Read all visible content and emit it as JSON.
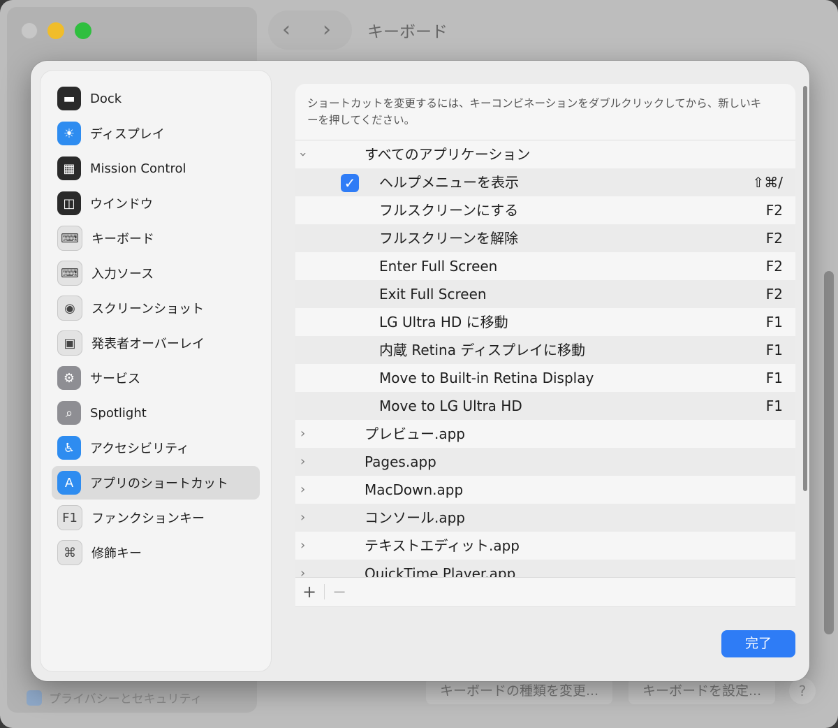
{
  "window": {
    "title": "キーボード",
    "nav_back": "‹",
    "nav_forward": "›",
    "privacy_label": "プライバシーとセキュリティ",
    "change_keyboard_type_button": "キーボードの種類を変更...",
    "setup_keyboard_button": "キーボードを設定...",
    "help_button": "?"
  },
  "sidebar": {
    "items": [
      {
        "label": "Dock",
        "icon": "dock-icon",
        "glyph": "▬"
      },
      {
        "label": "ディスプレイ",
        "icon": "display-icon",
        "glyph": "☀"
      },
      {
        "label": "Mission Control",
        "icon": "mission-control-icon",
        "glyph": "▦"
      },
      {
        "label": "ウインドウ",
        "icon": "window-icon",
        "glyph": "◫"
      },
      {
        "label": "キーボード",
        "icon": "keyboard-icon",
        "glyph": "⌨"
      },
      {
        "label": "入力ソース",
        "icon": "input-source-icon",
        "glyph": "⌨"
      },
      {
        "label": "スクリーンショット",
        "icon": "screenshot-icon",
        "glyph": "◉"
      },
      {
        "label": "発表者オーバーレイ",
        "icon": "presenter-overlay-icon",
        "glyph": "▣"
      },
      {
        "label": "サービス",
        "icon": "services-icon",
        "glyph": "⚙"
      },
      {
        "label": "Spotlight",
        "icon": "spotlight-icon",
        "glyph": "⌕"
      },
      {
        "label": "アクセシビリティ",
        "icon": "accessibility-icon",
        "glyph": "♿"
      },
      {
        "label": "アプリのショートカット",
        "icon": "app-shortcuts-icon",
        "glyph": "A"
      },
      {
        "label": "ファンクションキー",
        "icon": "function-keys-icon",
        "glyph": "F1"
      },
      {
        "label": "修飾キー",
        "icon": "modifier-keys-icon",
        "glyph": "⌘"
      }
    ],
    "selected_index": 11
  },
  "content": {
    "description": "ショートカットを変更するには、キーコンビネーションをダブルクリックしてから、新しいキーを押してください。",
    "rows": [
      {
        "label": "すべてのアプリケーション",
        "key": "",
        "level": 0,
        "expander": "down"
      },
      {
        "label": "ヘルプメニューを表示",
        "key": "⇧⌘/",
        "level": 1,
        "checked": true
      },
      {
        "label": "フルスクリーンにする",
        "key": "F2",
        "level": 1
      },
      {
        "label": "フルスクリーンを解除",
        "key": "F2",
        "level": 1
      },
      {
        "label": "Enter Full Screen",
        "key": "F2",
        "level": 1
      },
      {
        "label": "Exit Full Screen",
        "key": "F2",
        "level": 1
      },
      {
        "label": "LG Ultra HD に移動",
        "key": "F1",
        "level": 1
      },
      {
        "label": "内蔵 Retina ディスプレイに移動",
        "key": "F1",
        "level": 1
      },
      {
        "label": "Move to Built-in Retina Display",
        "key": "F1",
        "level": 1
      },
      {
        "label": "Move to LG Ultra HD",
        "key": "F1",
        "level": 1
      },
      {
        "label": "プレビュー.app",
        "key": "",
        "level": 0,
        "expander": "right"
      },
      {
        "label": "Pages.app",
        "key": "",
        "level": 0,
        "expander": "right"
      },
      {
        "label": "MacDown.app",
        "key": "",
        "level": 0,
        "expander": "right"
      },
      {
        "label": "コンソール.app",
        "key": "",
        "level": 0,
        "expander": "right"
      },
      {
        "label": "テキストエディット.app",
        "key": "",
        "level": 0,
        "expander": "right"
      },
      {
        "label": "QuickTime Player.app",
        "key": "",
        "level": 0,
        "expander": "right"
      }
    ],
    "add_button": "+",
    "remove_button": "−",
    "checkmark": "✓",
    "chevron_right": "›"
  },
  "footer": {
    "done_button": "完了"
  },
  "colors": {
    "accent": "#2e7cf6",
    "selected_row": "#dcdcdc"
  }
}
